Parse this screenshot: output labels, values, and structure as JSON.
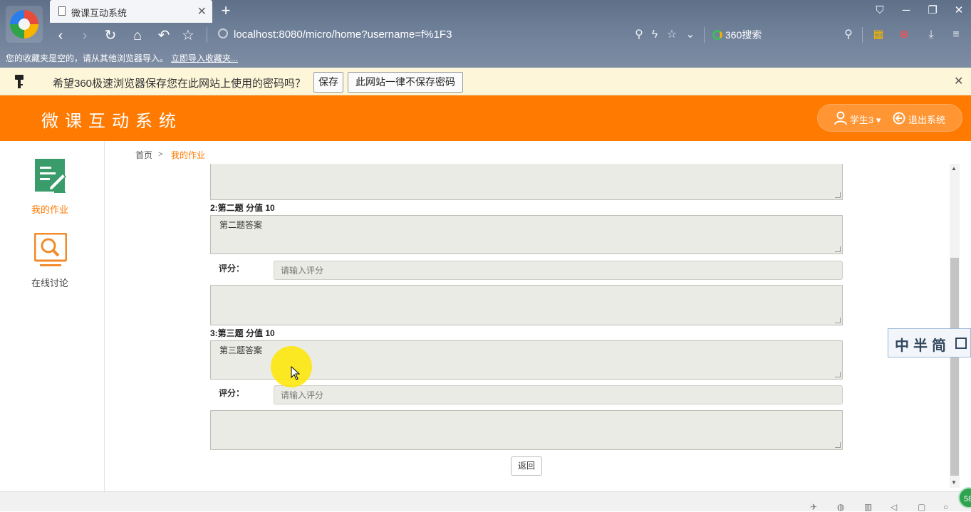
{
  "browser": {
    "tab_title": "微课互动系统",
    "tab_close": "✕",
    "new_tab": "+",
    "url": "localhost:8080/micro/home?username=f%1F3",
    "search_engine": "360搜索",
    "bookmarks_text": "您的收藏夹是空的，请从其他浏览器导入。",
    "bookmarks_link": "立即导入收藏夹..."
  },
  "password_bar": {
    "message": "希望360极速浏览器保存您在此网站上使用的密码吗？",
    "save_label": "保存",
    "never_label": "此网站一律不保存密码",
    "close": "✕"
  },
  "header": {
    "title": "微课互动系统",
    "user_name": "学生3 ▾",
    "logout_label": "退出系统"
  },
  "sidebar": {
    "items": [
      {
        "label": "我的作业",
        "icon": "homework-icon",
        "active": true
      },
      {
        "label": "在线讨论",
        "icon": "discussion-icon",
        "active": false
      }
    ]
  },
  "breadcrumb": {
    "home": "首页",
    "separator": ">",
    "current": "我的作业"
  },
  "questions": [
    {
      "title": "2:第二题 分值 10",
      "answer": "第二题答案",
      "score_label": "评分：",
      "score_placeholder": "请输入评分",
      "comment": ""
    },
    {
      "title": "3:第三题 分值 10",
      "answer": "第三题答案",
      "score_label": "评分：",
      "score_placeholder": "请输入评分",
      "comment": ""
    }
  ],
  "back_label": "返回",
  "ime": {
    "text": "中半简"
  },
  "colors": {
    "accent": "#ff7a00",
    "password_bar_bg": "#fdf6d8",
    "textarea_bg": "#ebebe6"
  }
}
